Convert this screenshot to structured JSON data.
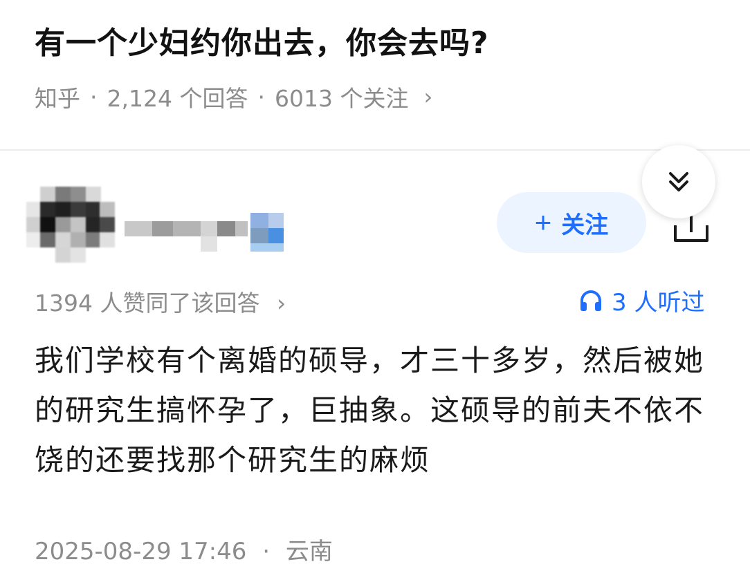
{
  "question": {
    "title": "有一个少妇约你出去，你会去吗?",
    "source": "知乎",
    "answers": "2,124 个回答",
    "followers": "6013 个关注",
    "chevron": "›"
  },
  "author": {
    "follow_plus": "+",
    "follow_label": "关注"
  },
  "answer": {
    "votes": "1394 人赞同了该回答",
    "votes_chevron": "›",
    "listened": "3 人听过",
    "body": "我们学校有个离婚的硕导，才三十多岁，然后被她的研究生搞怀孕了，巨抽象。这硕导的前夫不依不饶的还要找那个研究生的麻烦",
    "date": "2025-08-29 17:46",
    "location": "云南"
  },
  "icons": {
    "collapse": "double-chevron-down-icon",
    "share": "share-icon",
    "headphones": "headphones-icon"
  },
  "colors": {
    "accent": "#1e6fff",
    "follow_bg": "#ebf4ff",
    "meta_gray": "#8c8c8c"
  }
}
